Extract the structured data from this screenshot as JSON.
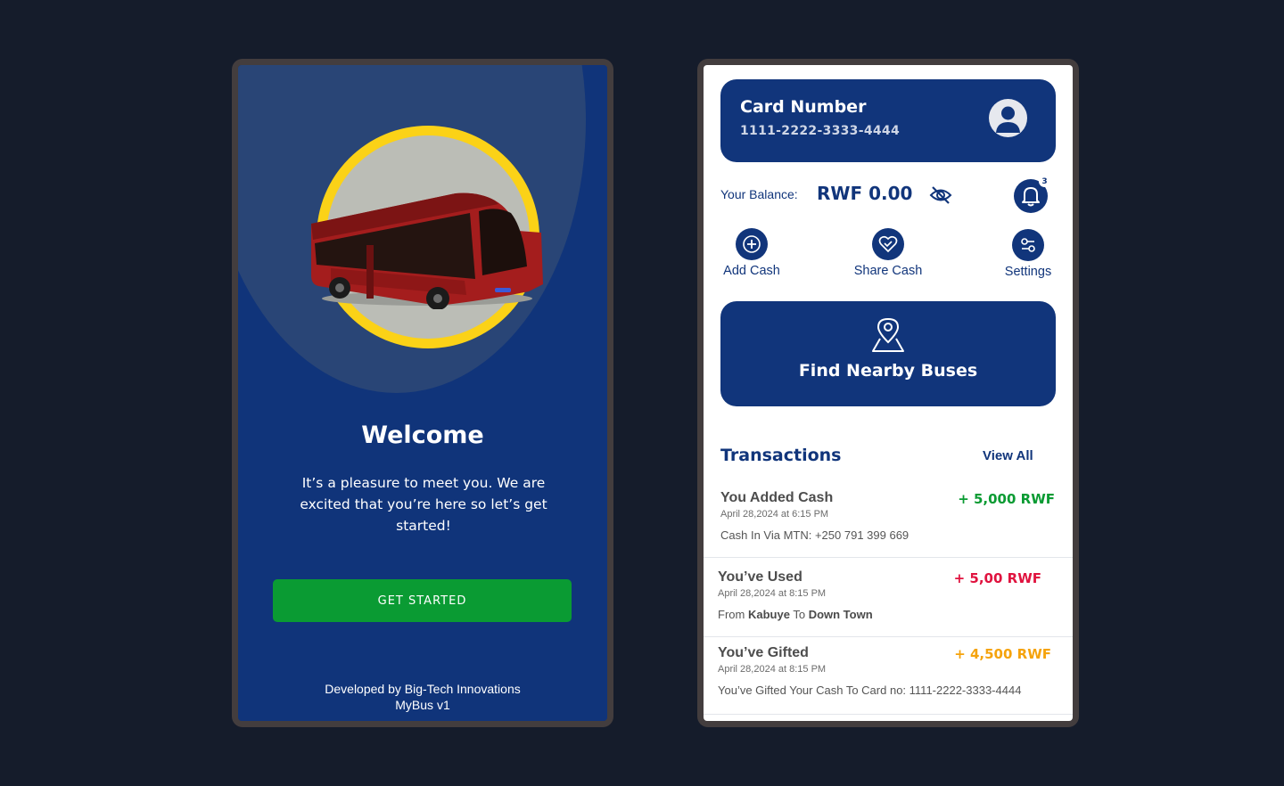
{
  "welcome_screen": {
    "title": "Welcome",
    "message": "It’s a pleasure to meet you. We are excited that you’re here so let’s get started!",
    "cta_label": "GET STARTED",
    "footer_line1": "Developed by Big-Tech Innovations",
    "footer_line2": "MyBus v1"
  },
  "dashboard": {
    "card": {
      "title": "Card Number",
      "number": "1111-2222-3333-4444"
    },
    "balance": {
      "label": "Your Balance:",
      "value": "RWF 0.00"
    },
    "notifications_count": "3",
    "actions": [
      {
        "label": "Add Cash",
        "icon": "plus-icon"
      },
      {
        "label": "Share Cash",
        "icon": "heart-share-icon"
      },
      {
        "label": "Settings",
        "icon": "sliders-icon"
      }
    ],
    "find_buses_label": "Find Nearby Buses",
    "transactions_title": "Transactions",
    "view_all_label": "View All",
    "transactions": [
      {
        "name": "You Added Cash",
        "date": "April 28,2024 at 6:15 PM",
        "description": "Cash In Via MTN: +250 791 399 669",
        "amount": "+ 5,000 RWF",
        "color": "#0a9b33"
      },
      {
        "name": "You’ve Used",
        "date": "April 28,2024 at 8:15 PM",
        "desc_from": "From",
        "desc_origin": "Kabuye",
        "desc_to": "To",
        "desc_destination": "Down Town",
        "amount": "+ 5,00 RWF",
        "color": "#e0133f"
      },
      {
        "name": "You’ve Gifted",
        "date": "April 28,2024 at 8:15 PM",
        "description": "You’ve Gifted Your Cash To Card no: 1111-2222-3333-4444",
        "amount": "+ 4,500 RWF",
        "color": "#f5a30c"
      }
    ]
  },
  "colors": {
    "brand_blue": "#11357b",
    "accent_yellow": "#fbd217",
    "success_green": "#0a9b33"
  }
}
